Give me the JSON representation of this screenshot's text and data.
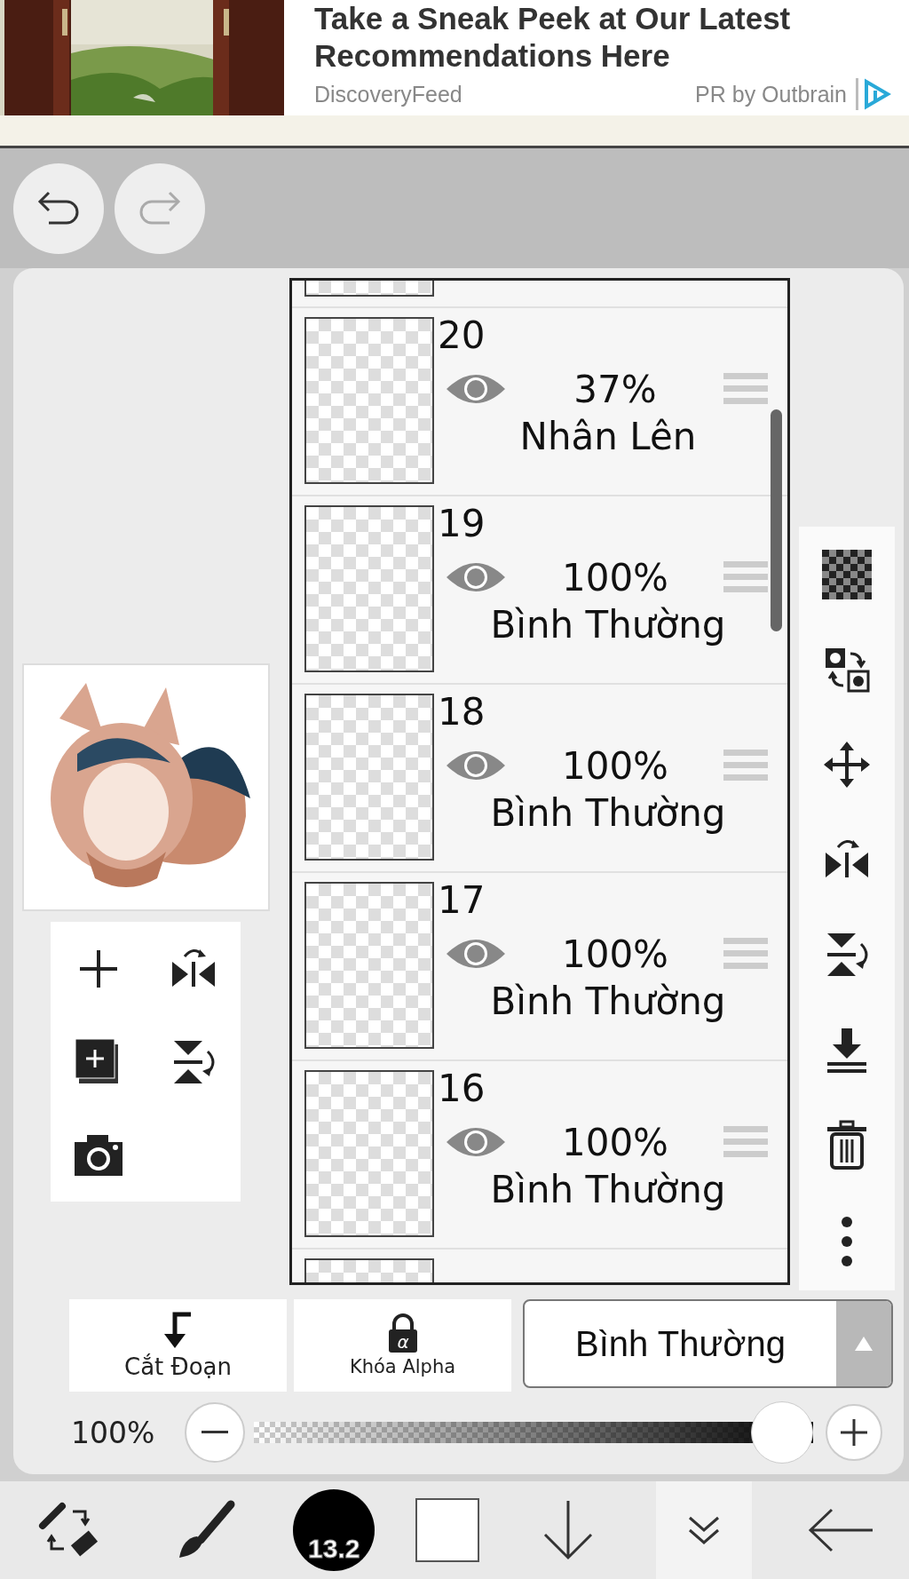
{
  "ad": {
    "title": "Take a Sneak Peek at Our Latest Recommendations Here",
    "source": "DiscoveryFeed",
    "sponsor": "PR by Outbrain"
  },
  "layers": [
    {
      "number": "20",
      "opacity": "37%",
      "blend": "Nhân Lên",
      "visible": true
    },
    {
      "number": "19",
      "opacity": "100%",
      "blend": "Bình Thường",
      "visible": true
    },
    {
      "number": "18",
      "opacity": "100%",
      "blend": "Bình Thường",
      "visible": true
    },
    {
      "number": "17",
      "opacity": "100%",
      "blend": "Bình Thường",
      "visible": true
    },
    {
      "number": "16",
      "opacity": "100%",
      "blend": "Bình Thường",
      "visible": true
    }
  ],
  "layer_actions": [
    {
      "label": "Cắt Đoạn",
      "kind": "clip"
    },
    {
      "label": "Khóa Alpha",
      "kind": "lock",
      "glyph": "α"
    }
  ],
  "blend_mode": {
    "value": "Bình Thường"
  },
  "opacity": {
    "reading": "100%",
    "level": 1
  },
  "toolbar": {
    "brush_size": "13.2"
  }
}
